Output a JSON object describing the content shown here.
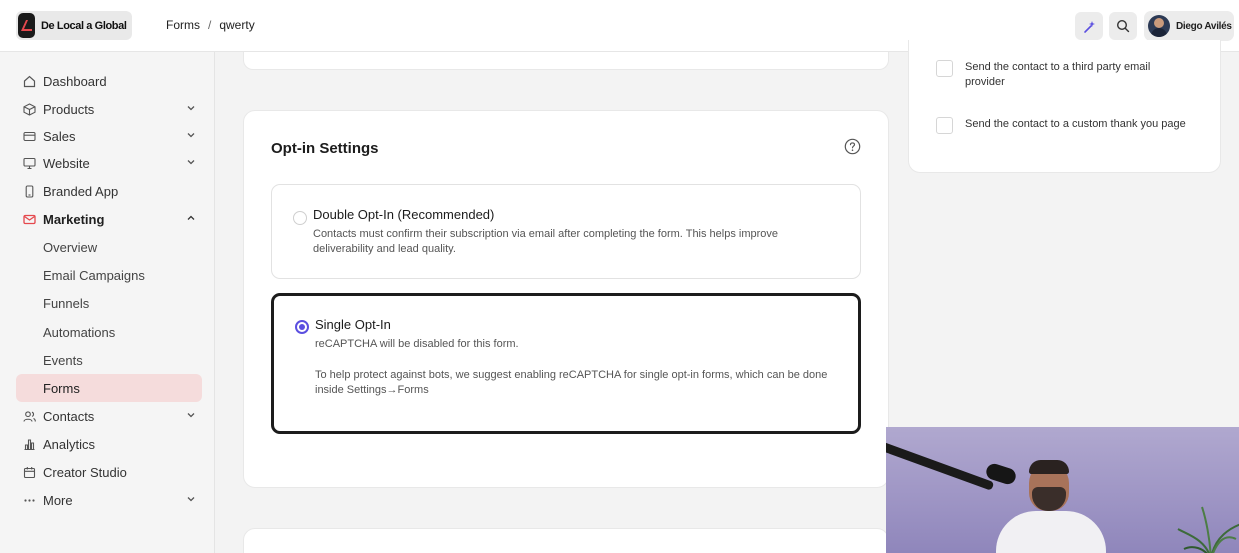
{
  "header": {
    "brand_name": "De Local a Global",
    "breadcrumb": [
      "Forms",
      "qwerty"
    ],
    "breadcrumb_separator": "/",
    "user_name": "Diego Avilés"
  },
  "sidebar": {
    "items": [
      {
        "label": "Dashboard",
        "icon": "home-icon"
      },
      {
        "label": "Products",
        "icon": "box-icon",
        "expandable": true
      },
      {
        "label": "Sales",
        "icon": "card-icon",
        "expandable": true
      },
      {
        "label": "Website",
        "icon": "monitor-icon",
        "expandable": true
      },
      {
        "label": "Branded App",
        "icon": "phone-icon"
      },
      {
        "label": "Marketing",
        "icon": "mail-icon",
        "expanded": true,
        "color": "#e5484d"
      },
      {
        "label": "Contacts",
        "icon": "users-icon",
        "expandable": true
      },
      {
        "label": "Analytics",
        "icon": "chart-icon"
      },
      {
        "label": "Creator Studio",
        "icon": "calendar-icon"
      },
      {
        "label": "More",
        "icon": "ellipsis-icon",
        "expandable": true
      }
    ],
    "marketing_children": [
      "Overview",
      "Email Campaigns",
      "Funnels",
      "Automations",
      "Events",
      "Forms"
    ],
    "selected_child": "Forms"
  },
  "optin": {
    "title": "Opt-in Settings",
    "options": [
      {
        "title": "Double Opt-In (Recommended)",
        "description": "Contacts must confirm their subscription via email after completing the form. This helps improve deliverability and lead quality.",
        "selected": false
      },
      {
        "title": "Single Opt-In",
        "description": "reCAPTCHA will be disabled for this form.",
        "note": "To help protect against bots, we suggest enabling reCAPTCHA for single opt-in forms, which can be done inside Settings→Forms",
        "selected": true
      }
    ]
  },
  "actions": {
    "checkboxes": [
      {
        "label": "Send the contact to a third party email provider",
        "checked": false
      },
      {
        "label": "Send the contact to a custom thank you page",
        "checked": false
      }
    ]
  },
  "colors": {
    "accent": "#5b4fe0",
    "marketing": "#e5484d",
    "selected_bg": "#f5dcdc"
  }
}
